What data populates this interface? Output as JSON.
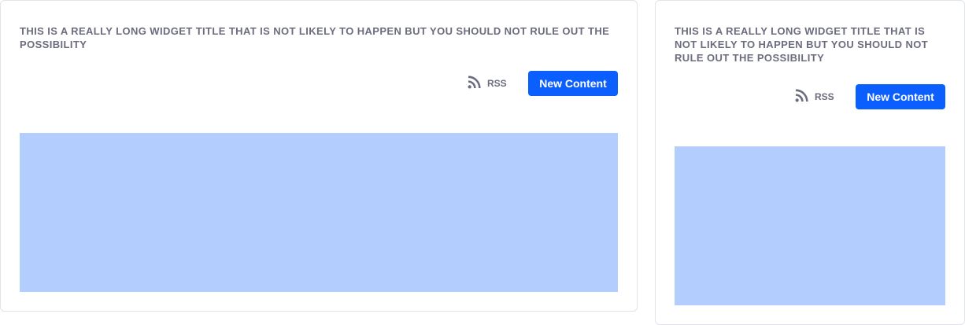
{
  "widgets": [
    {
      "title": "THIS IS A REALLY LONG WIDGET TITLE THAT IS NOT LIKELY TO HAPPEN BUT YOU SHOULD NOT RULE OUT THE POSSIBILITY",
      "rss_label": "RSS",
      "rss_icon": "rss-icon",
      "new_content_label": "New Content"
    },
    {
      "title": "THIS IS A REALLY LONG WIDGET TITLE THAT IS NOT LIKELY TO HAPPEN BUT YOU SHOULD NOT RULE OUT THE POSSIBILITY",
      "rss_label": "RSS",
      "rss_icon": "rss-icon",
      "new_content_label": "New Content"
    }
  ],
  "colors": {
    "primary": "#0b5fff",
    "placeholder": "#b3cdff",
    "secondary_text": "#6b6c7e",
    "border": "#e2e3e8"
  }
}
